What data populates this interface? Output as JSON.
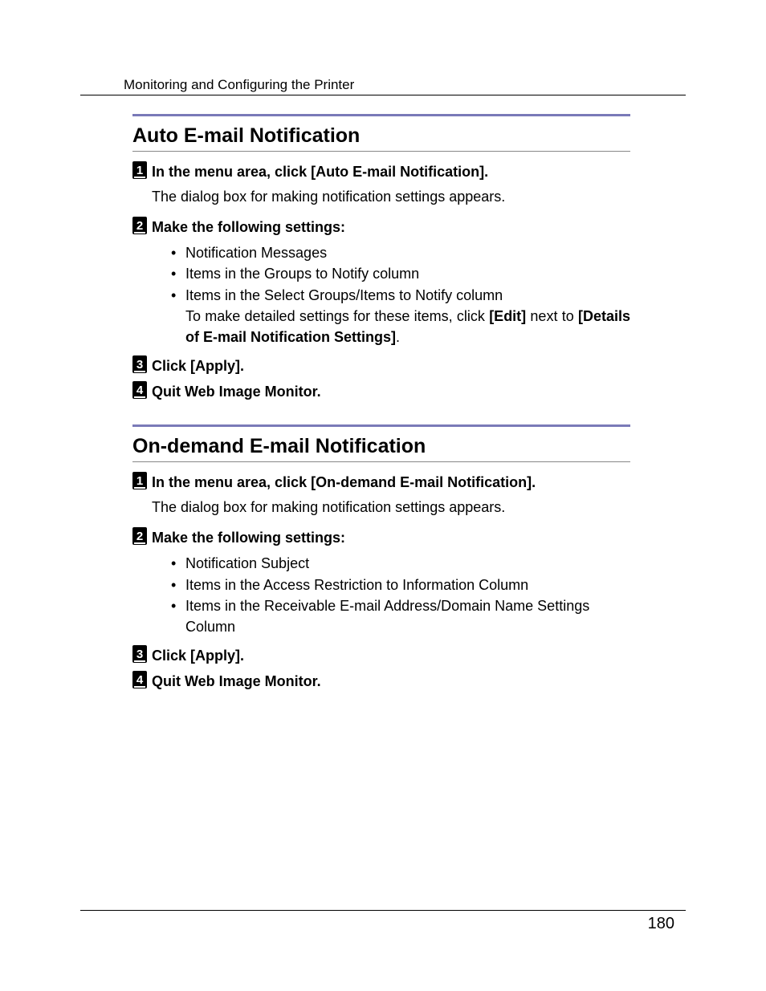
{
  "header": {
    "title": "Monitoring and Configuring the Printer"
  },
  "sections": [
    {
      "title": "Auto E-mail Notification",
      "steps": [
        {
          "n": "1",
          "lead": "In the menu area, click ",
          "bracket": "[Auto E-mail Notification]",
          "tail": ".",
          "desc": "The dialog box for making notification settings appears."
        },
        {
          "n": "2",
          "lead": "Make the following settings:",
          "bullets": [
            "Notification Messages",
            "Items in the Groups to Notify column",
            "Items in the Select Groups/Items to Notify column"
          ],
          "detail_pre": "To make detailed settings for these items, click ",
          "detail_b1": "[Edit]",
          "detail_mid": " next to ",
          "detail_b2": "[Details of E-mail Notification Settings]",
          "detail_post": "."
        },
        {
          "n": "3",
          "lead": "Click ",
          "bracket": "[Apply]",
          "tail": "."
        },
        {
          "n": "4",
          "lead": "Quit Web Image Monitor."
        }
      ]
    },
    {
      "title": "On-demand E-mail Notification",
      "steps": [
        {
          "n": "1",
          "lead": "In the menu area, click ",
          "bracket": "[On-demand E-mail Notification]",
          "tail": ".",
          "desc": "The dialog box for making notification settings appears."
        },
        {
          "n": "2",
          "lead": "Make the following settings:",
          "bullets": [
            "Notification Subject",
            "Items in the Access Restriction to Information Column",
            "Items in the Receivable E-mail Address/Domain Name Settings Column"
          ]
        },
        {
          "n": "3",
          "lead": "Click ",
          "bracket": "[Apply]",
          "tail": "."
        },
        {
          "n": "4",
          "lead": "Quit Web Image Monitor."
        }
      ]
    }
  ],
  "page_number": "180"
}
